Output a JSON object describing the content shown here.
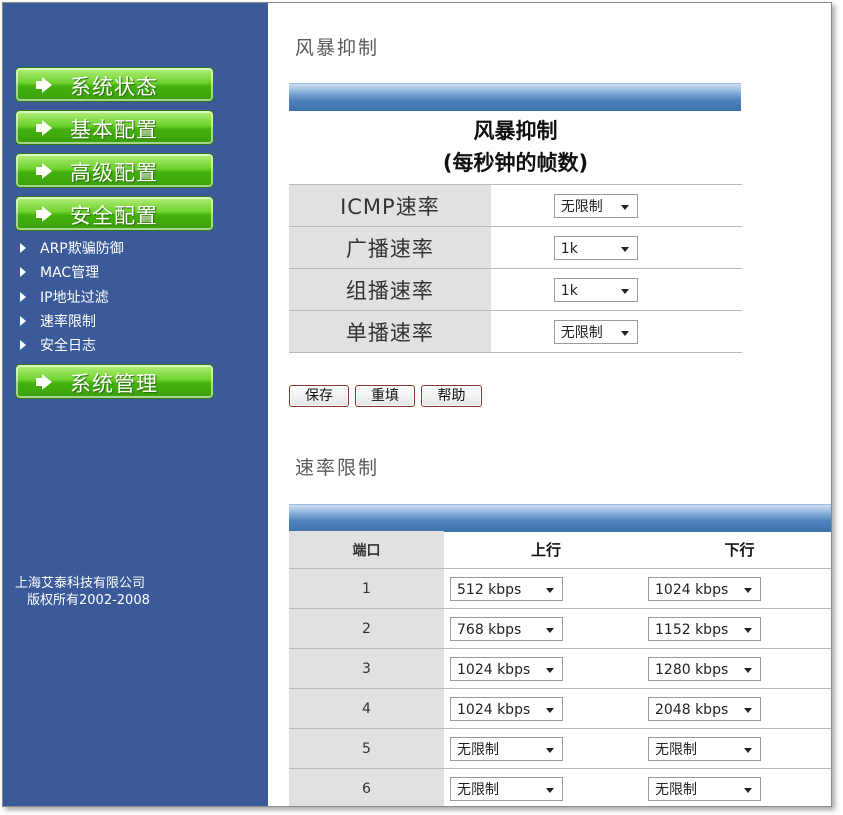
{
  "sidebar": {
    "nav": [
      {
        "label": "系统状态"
      },
      {
        "label": "基本配置"
      },
      {
        "label": "高级配置"
      },
      {
        "label": "安全配置"
      }
    ],
    "subitems": [
      {
        "label": "ARP欺骗防御"
      },
      {
        "label": "MAC管理"
      },
      {
        "label": "IP地址过滤"
      },
      {
        "label": "速率限制"
      },
      {
        "label": "安全日志"
      }
    ],
    "nav_bottom": {
      "label": "系统管理"
    },
    "copyright": {
      "line1": "上海艾泰科技有限公司",
      "line2": "版权所有2002-2008"
    }
  },
  "storm": {
    "section_title": "风暴抑制",
    "table_title_1": "风暴抑制",
    "table_title_2": "(每秒钟的帧数)",
    "rows": [
      {
        "label": "ICMP速率",
        "value": "无限制"
      },
      {
        "label": "广播速率",
        "value": "1k"
      },
      {
        "label": "组播速率",
        "value": "1k"
      },
      {
        "label": "单播速率",
        "value": "无限制"
      }
    ],
    "buttons": {
      "save": "保存",
      "reset": "重填",
      "help": "帮助"
    }
  },
  "rate_limit": {
    "section_title": "速率限制",
    "headers": {
      "port": "端口",
      "up": "上行",
      "down": "下行"
    },
    "rows": [
      {
        "port": "1",
        "up": "512 kbps",
        "down": "1024 kbps"
      },
      {
        "port": "2",
        "up": "768 kbps",
        "down": "1152 kbps"
      },
      {
        "port": "3",
        "up": "1024 kbps",
        "down": "1280 kbps"
      },
      {
        "port": "4",
        "up": "1024 kbps",
        "down": "2048 kbps"
      },
      {
        "port": "5",
        "up": "无限制",
        "down": "无限制"
      },
      {
        "port": "6",
        "up": "无限制",
        "down": "无限制"
      }
    ]
  },
  "colors": {
    "sidebar_bg": "#3a5a99",
    "nav_green": "#44b10f",
    "bar_blue": "#4f81bd"
  }
}
